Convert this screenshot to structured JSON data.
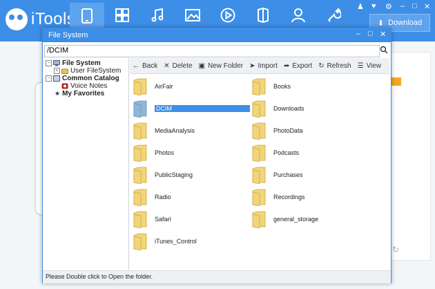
{
  "app": {
    "name": "iTools",
    "download_label": "Download"
  },
  "nav": {
    "icons": [
      "device-icon",
      "apps-icon",
      "music-icon",
      "photos-icon",
      "video-icon",
      "books-icon",
      "contacts-icon",
      "tools-icon"
    ]
  },
  "dialog": {
    "title": "File System",
    "path": "/DCIM",
    "status": "Please Double click to Open the folder.",
    "tree": [
      {
        "label": "File System",
        "bold": true
      },
      {
        "label": "User FileSystem",
        "bold": false
      },
      {
        "label": "Common Catalog",
        "bold": true
      },
      {
        "label": "Voice Notes",
        "bold": false
      },
      {
        "label": "My Favorites",
        "bold": true
      }
    ],
    "toolbar": [
      "Back",
      "Delete",
      "New Folder",
      "Import",
      "Export",
      "Refresh",
      "View"
    ],
    "folders": [
      "AirFair",
      "Books",
      "DCIM",
      "Downloads",
      "MediaAnalysis",
      "PhotoData",
      "Photos",
      "Podcasts",
      "PublicStaging",
      "Purchases",
      "Radio",
      "Recordings",
      "Safari",
      "general_storage",
      "iTunes_Control"
    ],
    "selected_folder": "DCIM"
  },
  "colors": {
    "accent": "#3d8ee6",
    "folder": "#f2d479",
    "selected_folder": "#8fb6d8"
  }
}
